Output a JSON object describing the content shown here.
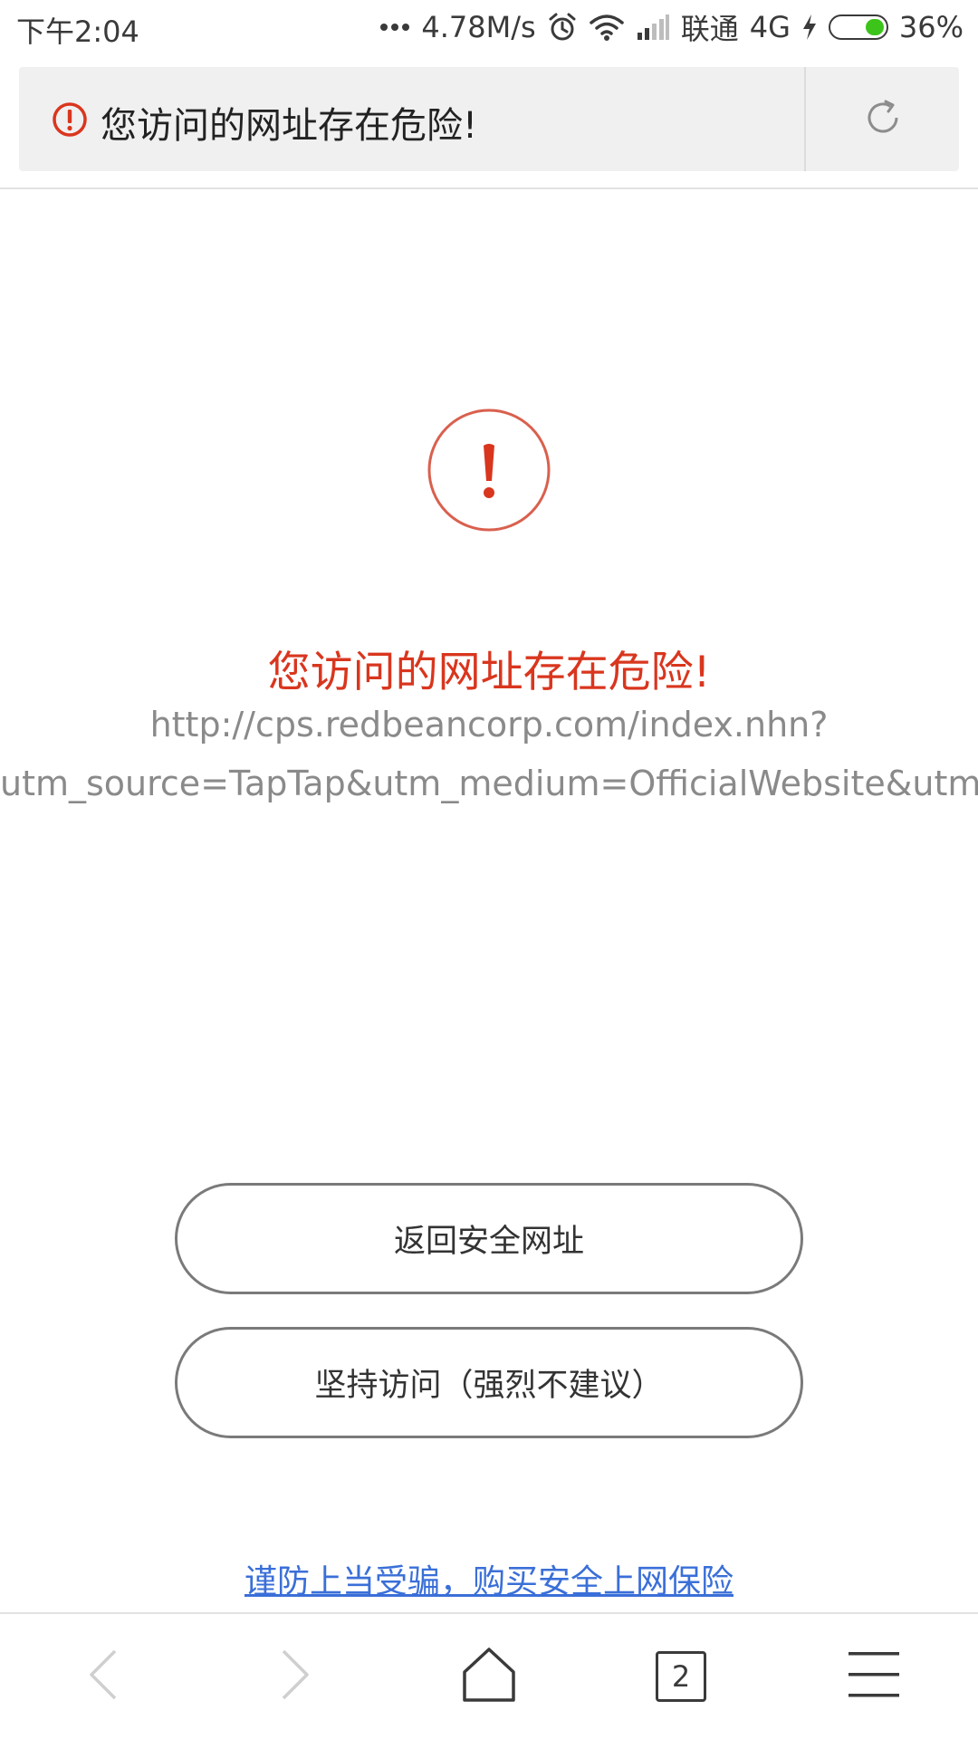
{
  "status_bar": {
    "time": "下午2:04",
    "network_speed": "4.78M/s",
    "carrier": "联通",
    "network_type": "4G",
    "battery_percent": "36%",
    "battery_level": 0.36,
    "icons": [
      "more-dots-icon",
      "alarm-icon",
      "wifi-icon",
      "signal-icon",
      "charging-icon",
      "battery-icon"
    ]
  },
  "address_bar": {
    "title": "您访问的网址存在危险!",
    "warning_icon": "warning-circle-icon",
    "reload_icon": "reload-icon"
  },
  "warning": {
    "icon": "exclamation-circle-icon",
    "heading": "您访问的网址存在危险!",
    "url_line_1": "http://cps.redbeancorp.com/index.nhn?",
    "url_line_2": "utm_source=TapTap&utm_medium=OfficialWebsite&utm_campaign"
  },
  "buttons": {
    "return_safe": "返回安全网址",
    "continue_visit": "坚持访问（强烈不建议）"
  },
  "insurance_link": "谨防上当受骗，购买安全上网保险",
  "toolbar": {
    "tabs_count": "2",
    "icons": [
      "back-icon",
      "forward-icon",
      "home-icon",
      "tabs-icon",
      "menu-icon"
    ]
  },
  "colors": {
    "danger": "#d9361e",
    "link": "#3a6fd8",
    "battery": "#3cc41b"
  }
}
